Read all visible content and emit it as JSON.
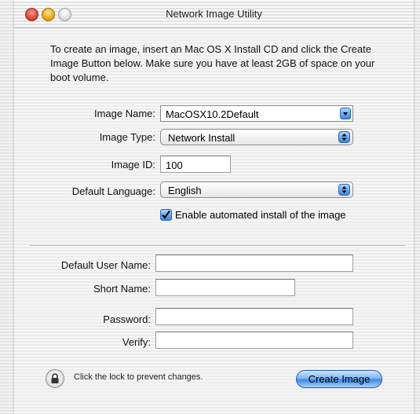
{
  "window": {
    "title": "Network Image Utility"
  },
  "instructions": "To create an image, insert an Mac OS X Install CD and click the Create Image Button below. Make sure you have at least 2GB of space on your boot volume.",
  "form": {
    "image_name": {
      "label": "Image Name:",
      "value": "MacOSX10.2Default"
    },
    "image_type": {
      "label": "Image Type:",
      "value": "Network Install"
    },
    "image_id": {
      "label": "Image ID:",
      "value": "100"
    },
    "default_language": {
      "label": "Default Language:",
      "value": "English"
    },
    "automated_install": {
      "label": "Enable automated install of the image",
      "checked": true
    }
  },
  "user": {
    "default_user_name": {
      "label": "Default User Name:",
      "value": ""
    },
    "short_name": {
      "label": "Short Name:",
      "value": ""
    },
    "password": {
      "label": "Password:",
      "value": ""
    },
    "verify": {
      "label": "Verify:",
      "value": ""
    }
  },
  "footer": {
    "lock_text": "Click the lock to prevent changes.",
    "create_button": "Create Image"
  },
  "colors": {
    "accent": "#3f8be3"
  }
}
